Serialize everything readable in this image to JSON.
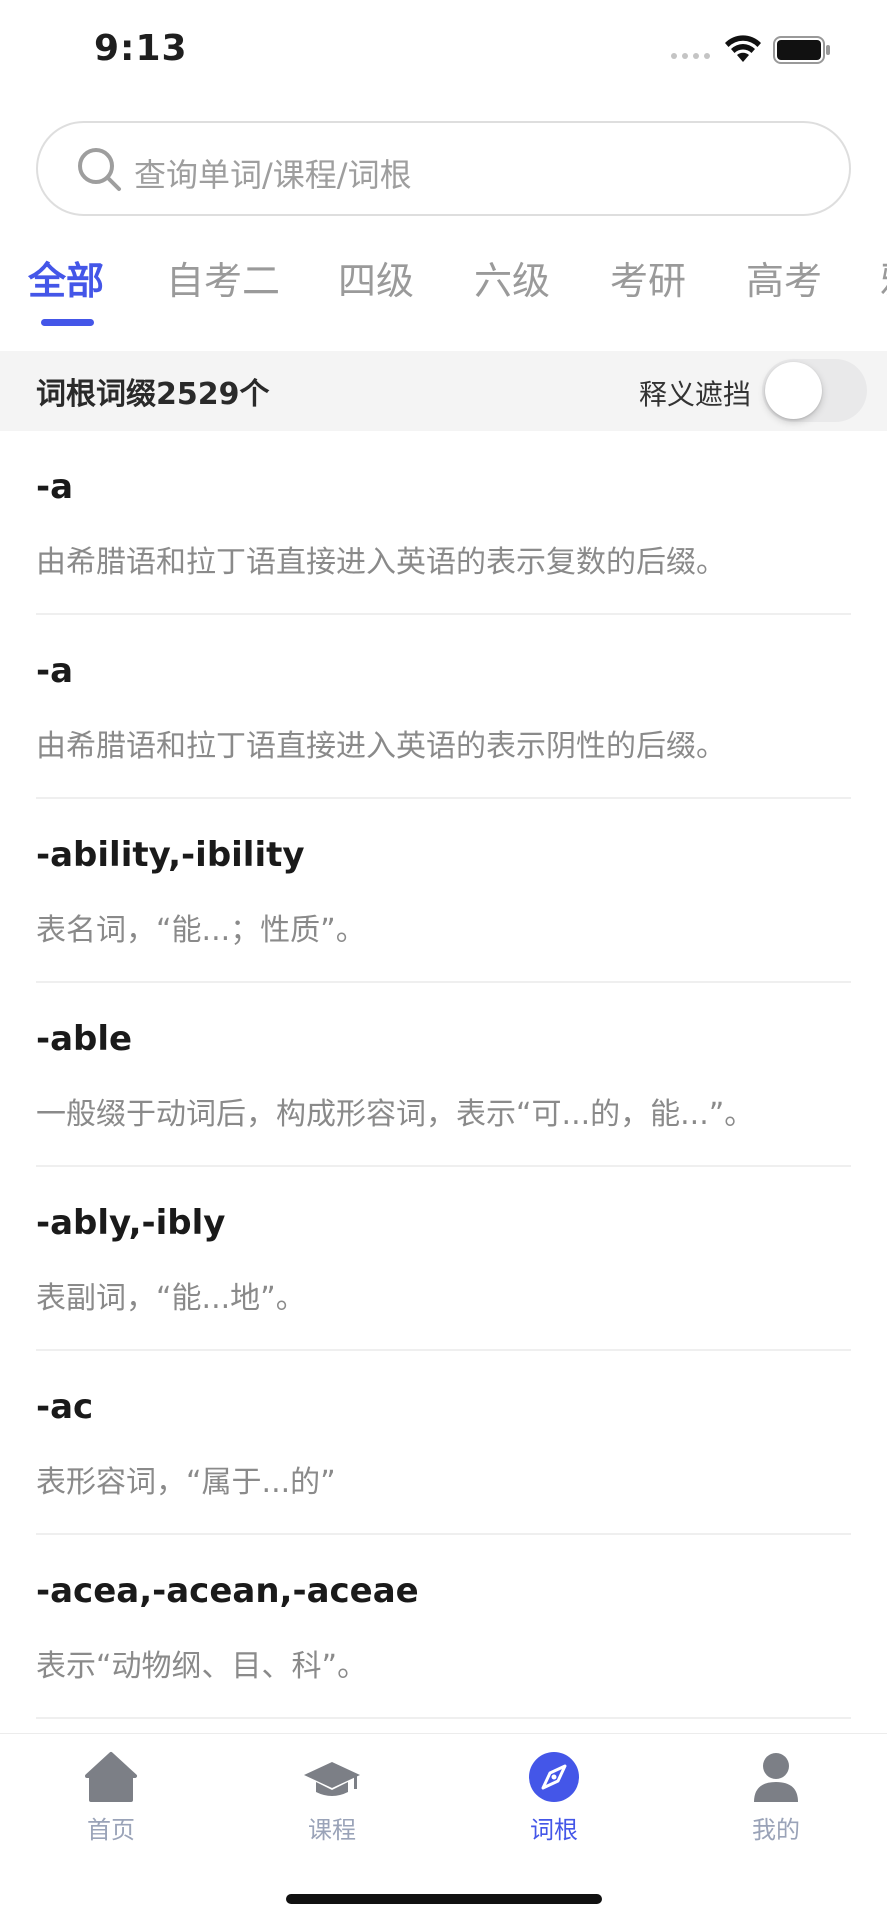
{
  "status_bar": {
    "time": "9:13"
  },
  "search": {
    "placeholder": "查询单词/课程/词根"
  },
  "tabs": [
    {
      "label": "全部",
      "active": true
    },
    {
      "label": "自考二",
      "active": false
    },
    {
      "label": "四级",
      "active": false
    },
    {
      "label": "六级",
      "active": false
    },
    {
      "label": "考研",
      "active": false
    },
    {
      "label": "高考",
      "active": false
    },
    {
      "label": "雅",
      "active": false
    }
  ],
  "count_bar": {
    "count_text": "词根词缀2529个",
    "mask_label": "释义遮挡",
    "mask_enabled": false
  },
  "roots": [
    {
      "title": "-a",
      "desc": "由希腊语和拉丁语直接进入英语的表示复数的后缀。"
    },
    {
      "title": "-a",
      "desc": "由希腊语和拉丁语直接进入英语的表示阴性的后缀。"
    },
    {
      "title": "-ability,-ibility",
      "desc": "表名词，“能...；性质”。"
    },
    {
      "title": "-able",
      "desc": "一般缀于动词后，构成形容词，表示“可...的，能...”。"
    },
    {
      "title": "-ably,-ibly",
      "desc": "表副词，“能...地”。"
    },
    {
      "title": "-ac",
      "desc": "表形容词，“属于...的”"
    },
    {
      "title": "-acea,-acean,-aceae",
      "desc": "表示“动物纲、目、科”。"
    }
  ],
  "tabbar": [
    {
      "label": "首页",
      "icon": "home-icon",
      "active": false
    },
    {
      "label": "课程",
      "icon": "graduation-cap-icon",
      "active": false
    },
    {
      "label": "词根",
      "icon": "compass-icon",
      "active": true
    },
    {
      "label": "我的",
      "icon": "person-icon",
      "active": false
    }
  ],
  "colors": {
    "accent": "#4456e8",
    "inactive_tab": "#9a9a9a",
    "tabbar_inactive": "#9aa3b8"
  }
}
